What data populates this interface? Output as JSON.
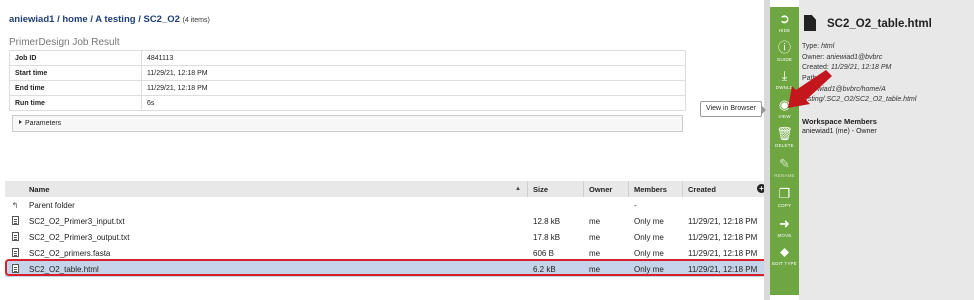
{
  "breadcrumb": {
    "parts": [
      "aniewiad1",
      "home",
      "A testing",
      "SC2_O2"
    ],
    "count": "(4 items)"
  },
  "job": {
    "title": "PrimerDesign Job Result",
    "rows": [
      {
        "label": "Job ID",
        "value": "4841113"
      },
      {
        "label": "Start time",
        "value": "11/29/21, 12:18 PM"
      },
      {
        "label": "End time",
        "value": "11/29/21, 12:18 PM"
      },
      {
        "label": "Run time",
        "value": "6s"
      }
    ],
    "parameters_label": "Parameters"
  },
  "files": {
    "columns": {
      "name": "Name",
      "size": "Size",
      "owner": "Owner",
      "members": "Members",
      "created": "Created"
    },
    "parent": {
      "name": "Parent folder",
      "members": "-"
    },
    "rows": [
      {
        "name": "SC2_O2_Primer3_input.txt",
        "size": "12.8 kB",
        "owner": "me",
        "members": "Only me",
        "created": "11/29/21, 12:18 PM"
      },
      {
        "name": "SC2_O2_Primer3_output.txt",
        "size": "17.8 kB",
        "owner": "me",
        "members": "Only me",
        "created": "11/29/21, 12:18 PM"
      },
      {
        "name": "SC2_O2_primers.fasta",
        "size": "606 B",
        "owner": "me",
        "members": "Only me",
        "created": "11/29/21, 12:18 PM"
      },
      {
        "name": "SC2_O2_table.html",
        "size": "6.2 kB",
        "owner": "me",
        "members": "Only me",
        "created": "11/29/21, 12:18 PM"
      }
    ]
  },
  "actions": {
    "hide": "HIDE",
    "guide": "GUIDE",
    "dwnld": "DWNLD",
    "view": "VIEW",
    "delete": "DELETE",
    "rename": "RENAME",
    "copy": "COPY",
    "move": "MOVE",
    "edit_type": "EDIT TYPE"
  },
  "tooltip": "View in Browser",
  "info": {
    "title": "SC2_O2_table.html",
    "type_label": "Type:",
    "type_value": "html",
    "owner_label": "Owner:",
    "owner_value": "aniewiad1@bvbrc",
    "created_label": "Created:",
    "created_value": "11/29/21, 12:18 PM",
    "path_label": "Path:",
    "path_line1": "/aniewiad1@bvbrc/home/A",
    "path_line2": "testing/.SC2_O2/SC2_O2_table.html",
    "workspace_title": "Workspace Members",
    "workspace_member": "aniewiad1 (me) - Owner"
  },
  "colors": {
    "action_bar": "#6ea742",
    "selected_row": "#c6d4ea",
    "highlight": "#d8202a",
    "breadcrumb": "#1f3f74"
  }
}
